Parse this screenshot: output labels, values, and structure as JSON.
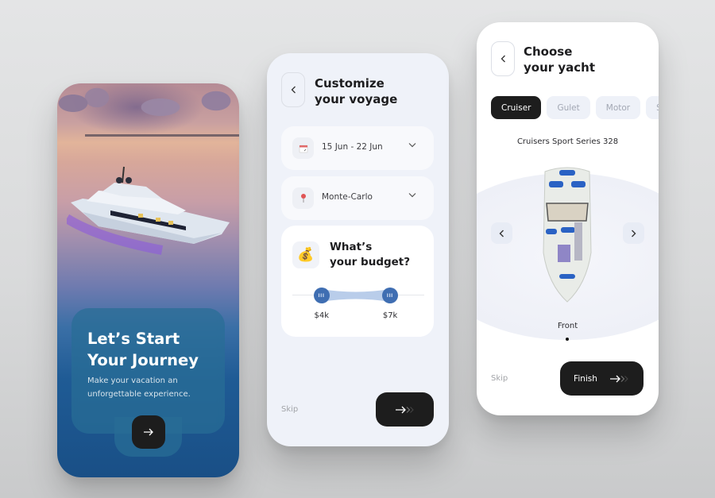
{
  "screen1": {
    "title": "Let’s Start Your Journey",
    "subtitle": "Make your vacation an unforgettable experience.",
    "next_icon": "arrow-right-icon"
  },
  "screen2": {
    "title_line1": "Customize",
    "title_line2": "your voyage",
    "back_icon": "chevron-left-icon",
    "date_field": {
      "icon": "calendar-icon",
      "value": "15 Jun - 22 Jun"
    },
    "location_field": {
      "icon": "map-pin-icon",
      "value": "Monte-Carlo"
    },
    "budget": {
      "icon": "money-bag-icon",
      "icon_glyph": "💰",
      "title_line1": "What’s",
      "title_line2": "your budget?",
      "min_label": "$4k",
      "max_label": "$7k",
      "min_value": 4,
      "max_value": 7,
      "min_position_fraction": 0.22,
      "max_position_fraction": 0.74
    },
    "skip_label": "Skip",
    "next_icon": "double-arrow-right-icon"
  },
  "screen3": {
    "title_line1": "Choose",
    "title_line2": "your yacht",
    "back_icon": "chevron-left-icon",
    "categories": [
      {
        "label": "Cruiser",
        "active": true
      },
      {
        "label": "Gulet",
        "active": false
      },
      {
        "label": "Motor",
        "active": false
      },
      {
        "label": "Sport",
        "active": false
      }
    ],
    "yacht_name": "Cruisers Sport Series 328",
    "view_label": "Front",
    "skip_label": "Skip",
    "finish_label": "Finish"
  },
  "colors": {
    "accent_blue": "#3f6eb2",
    "dark_button": "#1d1d1d",
    "screen_bg": "#eff2f9"
  }
}
